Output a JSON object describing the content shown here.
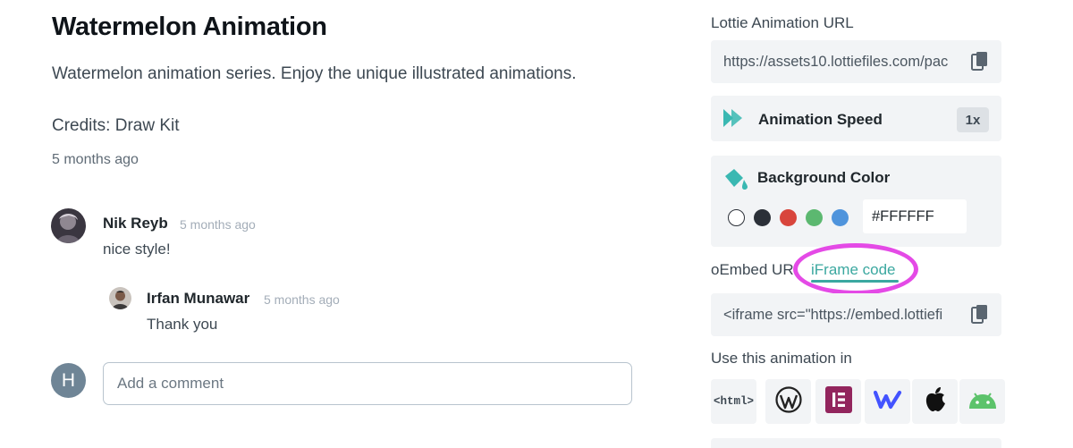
{
  "animation": {
    "title": "Watermelon Animation",
    "description": "Watermelon animation series. Enjoy the unique illustrated animations.",
    "credits": "Credits: Draw Kit",
    "posted": "5 months ago"
  },
  "comments": [
    {
      "author": "Nik Reyb",
      "time": "5 months ago",
      "text": "nice style!"
    },
    {
      "author": "Irfan Munawar",
      "time": "5 months ago",
      "text": "Thank you"
    }
  ],
  "comment_box": {
    "avatar_initial": "H",
    "placeholder": "Add a comment"
  },
  "sidebar": {
    "lottie_url_label": "Lottie Animation URL",
    "lottie_url_value": "https://assets10.lottiefiles.com/pac",
    "speed_label": "Animation Speed",
    "speed_value": "1x",
    "bg_label": "Background Color",
    "bg_hex": "#FFFFFF",
    "swatches": [
      "#ffffff",
      "#2b3038",
      "#d8453c",
      "#5cb870",
      "#4f94dc"
    ],
    "embed_tabs": {
      "oembed": "oEmbed URL",
      "iframe": "iFrame code"
    },
    "iframe_value": "<iframe src=\"https://embed.lottiefi",
    "use_in_label": "Use this animation in",
    "html_tag": "<html>",
    "apps": [
      "html",
      "wordpress",
      "elementor",
      "webflow",
      "apple",
      "android"
    ]
  },
  "colors": {
    "accent": "#3ba8a0",
    "highlight": "#e44ae6",
    "panel_bg": "#f2f4f6"
  }
}
